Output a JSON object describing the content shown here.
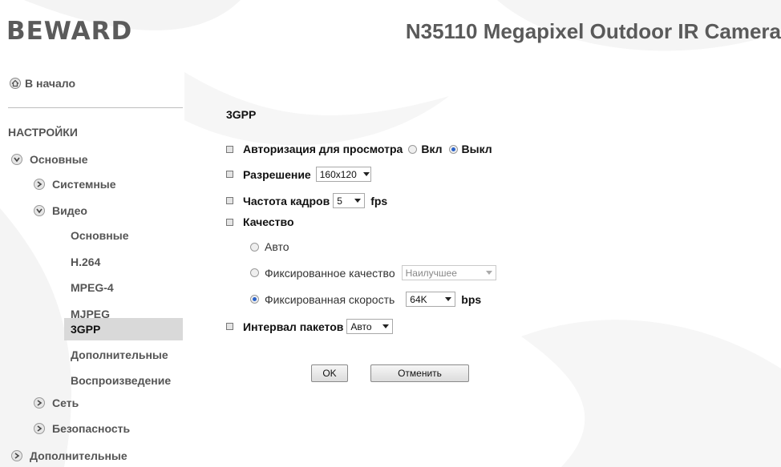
{
  "header": {
    "logo_text": "BEWARD",
    "camera_title": "N35110 Megapixel Outdoor IR Camera"
  },
  "sidebar": {
    "home_label": "В начало",
    "settings_heading": "НАСТРОЙКИ",
    "basic_label": "Основные",
    "system_label": "Системные",
    "video_label": "Видео",
    "video_sub": [
      "Основные",
      "H.264",
      "MPEG-4",
      "MJPEG",
      "3GPP",
      "Дополнительные",
      "Воспроизведение"
    ],
    "network_label": "Сеть",
    "security_label": "Безопасность",
    "extra_label": "Дополнительные"
  },
  "form": {
    "title": "3GPP",
    "auth_label": "Авторизация для просмотра",
    "auth_on": "Вкл",
    "auth_off": "Выкл",
    "auth_value": "off",
    "resolution_label": "Разрешение",
    "resolution_value": "160x120",
    "framerate_label": "Частота кадров",
    "framerate_value": "5",
    "framerate_unit": "fps",
    "quality_label": "Качество",
    "quality_auto": "Авто",
    "quality_fixed": "Фиксированное качество",
    "quality_fixed_value": "Наилучшее",
    "quality_bitrate": "Фиксированная скорость",
    "bitrate_value": "64K",
    "bitrate_unit": "bps",
    "quality_value": "bitrate",
    "packet_label": "Интервал пакетов",
    "packet_value": "Авто",
    "ok_label": "OK",
    "cancel_label": "Отменить"
  },
  "colors": {
    "logo": "#5b5b5b",
    "accent_radio": "#2a62c9",
    "active_bg": "#d9d9d9"
  }
}
